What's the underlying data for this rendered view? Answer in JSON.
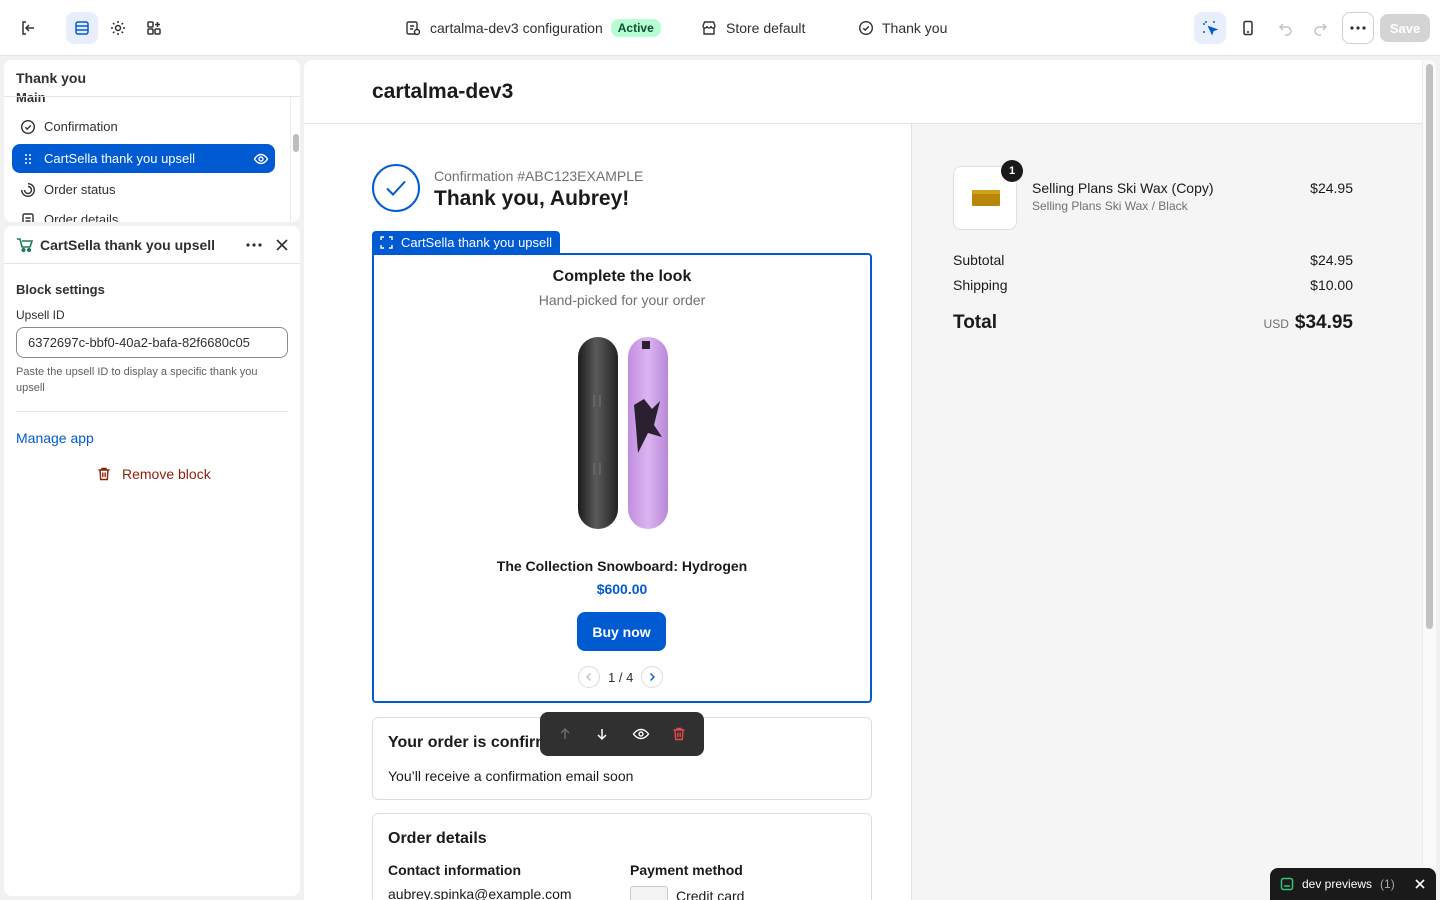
{
  "topbar": {
    "config_name": "cartalma-dev3 configuration",
    "status": "Active",
    "store": "Store default",
    "page": "Thank you",
    "save_label": "Save"
  },
  "tree": {
    "title": "Thank you",
    "section": "Main",
    "items": [
      {
        "label": "Confirmation",
        "icon": "check-circle-icon"
      },
      {
        "label": "CartSella thank you upsell",
        "icon": "drag-handle-icon",
        "selected": true
      },
      {
        "label": "Order status",
        "icon": "progress-icon"
      },
      {
        "label": "Order details",
        "icon": "receipt-icon"
      }
    ]
  },
  "settings": {
    "app_title": "CartSella thank you upsell",
    "section_title": "Block settings",
    "upsell_label": "Upsell ID",
    "upsell_value": "6372697c-bbf0-40a2-bafa-82f6680c05",
    "upsell_help": "Paste the upsell ID to display a specific thank you upsell",
    "manage_link": "Manage app",
    "remove_label": "Remove block"
  },
  "preview": {
    "shop_name": "cartalma-dev3",
    "confirmation_number": "Confirmation #ABC123EXAMPLE",
    "thank_you": "Thank you, Aubrey!",
    "upsell_tag": "CartSella thank you upsell",
    "upsell": {
      "title": "Complete the look",
      "subtitle": "Hand-picked for your order",
      "product_name": "The Collection Snowboard: Hydrogen",
      "price": "$600.00",
      "buy_label": "Buy now",
      "pager": "1 / 4"
    },
    "order_confirmed": {
      "heading": "Your order is confirmed",
      "text": "You’ll receive a confirmation email soon"
    },
    "order_details": {
      "heading": "Order details",
      "contact_heading": "Contact information",
      "contact_value": "aubrey.spinka@example.com",
      "payment_heading": "Payment method",
      "payment_value": "Credit card"
    }
  },
  "summary": {
    "item_name": "Selling Plans Ski Wax (Copy)",
    "item_variant": "Selling Plans Ski Wax / Black",
    "item_price": "$24.95",
    "item_qty": "1",
    "subtotal_label": "Subtotal",
    "subtotal_value": "$24.95",
    "shipping_label": "Shipping",
    "shipping_value": "$10.00",
    "total_label": "Total",
    "total_currency": "USD",
    "total_value": "$34.95"
  },
  "toast": {
    "label": "dev previews",
    "count": "(1)"
  },
  "colors": {
    "accent": "#005bd3",
    "active_badge": "#b4fed2",
    "critical": "#8e1f0b"
  }
}
